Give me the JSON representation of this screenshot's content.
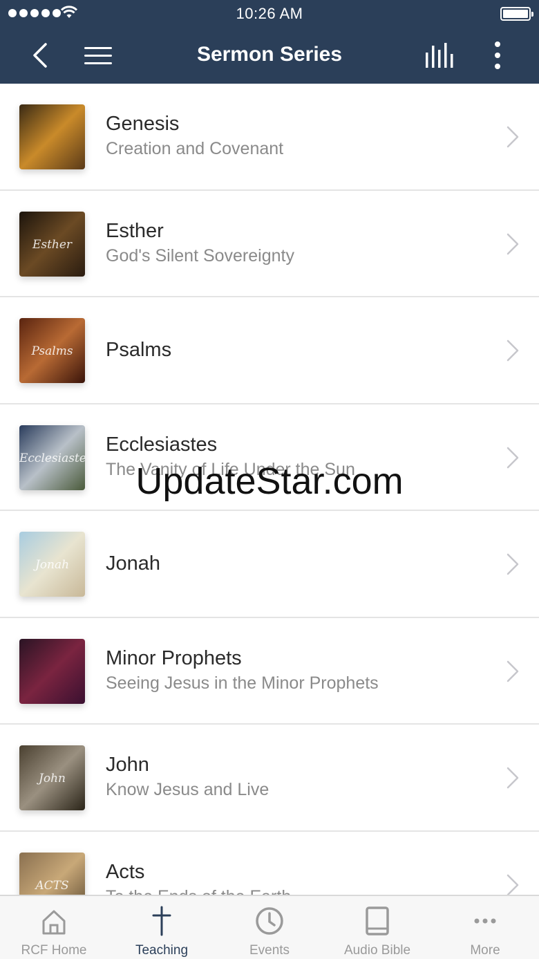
{
  "status_bar": {
    "time": "10:26 AM"
  },
  "nav": {
    "title": "Sermon Series"
  },
  "series": [
    {
      "title": "Genesis",
      "subtitle": "Creation and Covenant",
      "thumb_text": "",
      "thumb_colors": [
        "#3a2a14",
        "#c98a2a",
        "#5a3a18"
      ]
    },
    {
      "title": "Esther",
      "subtitle": "God's Silent Sovereignty",
      "thumb_text": "Esther",
      "thumb_colors": [
        "#1c140c",
        "#6b4a24",
        "#2a1c10"
      ]
    },
    {
      "title": "Psalms",
      "subtitle": "",
      "thumb_text": "Psalms",
      "thumb_colors": [
        "#5a2410",
        "#b86a34",
        "#3a140a"
      ]
    },
    {
      "title": "Ecclesiastes",
      "subtitle": "The Vanity of Life Under the Sun",
      "thumb_text": "Ecclesiastes",
      "thumb_colors": [
        "#2a3c5c",
        "#b8c0c8",
        "#4a5a3a"
      ]
    },
    {
      "title": "Jonah",
      "subtitle": "",
      "thumb_text": "Jonah",
      "thumb_colors": [
        "#a8cce0",
        "#e8e4d0",
        "#c8b898"
      ]
    },
    {
      "title": "Minor Prophets",
      "subtitle": "Seeing Jesus in the Minor Prophets",
      "thumb_text": "",
      "thumb_colors": [
        "#2a1424",
        "#7a2440",
        "#3a1030"
      ]
    },
    {
      "title": "John",
      "subtitle": "Know Jesus and Live",
      "thumb_text": "John",
      "thumb_colors": [
        "#4a4030",
        "#9a9080",
        "#2a2418"
      ]
    },
    {
      "title": "Acts",
      "subtitle": "To the Ends of the Earth",
      "thumb_text": "ACTS",
      "thumb_colors": [
        "#8a7050",
        "#c8a878",
        "#5a4830"
      ]
    }
  ],
  "watermark": "UpdateStar.com",
  "tabs": [
    {
      "label": "RCF Home",
      "icon": "home-icon",
      "active": false
    },
    {
      "label": "Teaching",
      "icon": "cross-icon",
      "active": true
    },
    {
      "label": "Events",
      "icon": "clock-icon",
      "active": false
    },
    {
      "label": "Audio Bible",
      "icon": "book-icon",
      "active": false
    },
    {
      "label": "More",
      "icon": "ellipsis-icon",
      "active": false
    }
  ],
  "colors": {
    "nav_background": "#2b3f59",
    "active_tab": "#2b3f59",
    "inactive_tab": "#9a9a9a",
    "subtitle": "#8a8a8a"
  }
}
